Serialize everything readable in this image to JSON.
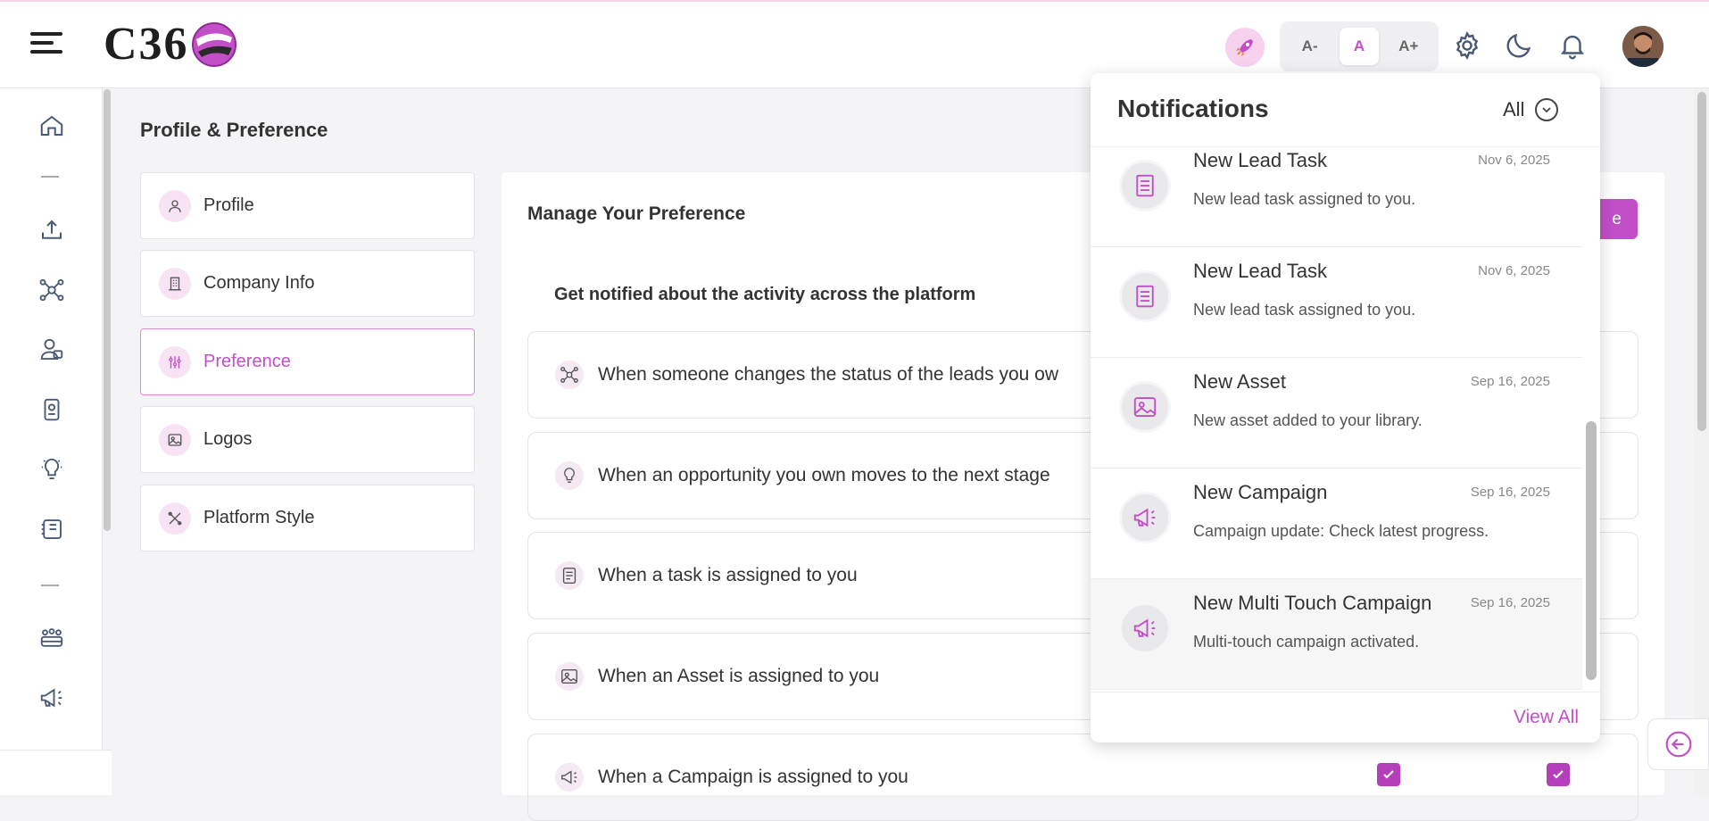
{
  "header": {
    "logo_text": "C36",
    "font_small": "A-",
    "font_normal": "A",
    "font_large": "A+"
  },
  "page": {
    "title": "Profile & Preference"
  },
  "profile_menu": [
    {
      "label": "Profile",
      "icon": "user-icon"
    },
    {
      "label": "Company Info",
      "icon": "building-icon"
    },
    {
      "label": "Preference",
      "icon": "sliders-icon",
      "active": true
    },
    {
      "label": "Logos",
      "icon": "image-icon"
    },
    {
      "label": "Platform Style",
      "icon": "tools-icon"
    }
  ],
  "preferences": {
    "title": "Manage Your Preference",
    "save_label": "Save",
    "save_visible": "e",
    "section_heading": "Get notified about the activity across the platform",
    "rows": [
      {
        "label": "When someone changes the status of the leads you ow",
        "icon": "network-icon"
      },
      {
        "label": "When an opportunity you own moves to the next stage",
        "icon": "bulb-icon"
      },
      {
        "label": "When a task is assigned to you",
        "icon": "task-icon"
      },
      {
        "label": "When an Asset is assigned to you",
        "icon": "image-icon"
      },
      {
        "label": "When a Campaign is assigned to you",
        "icon": "megaphone-icon",
        "email_checked": true,
        "inapp_checked": true
      }
    ]
  },
  "notifications": {
    "title": "Notifications",
    "filter": "All",
    "view_all": "View All",
    "items": [
      {
        "title": "New Lead Task",
        "date": "Nov 6, 2025",
        "body": "New lead task assigned to you.",
        "icon": "document-icon"
      },
      {
        "title": "New Lead Task",
        "date": "Nov 6, 2025",
        "body": "New lead task assigned to you.",
        "icon": "document-icon"
      },
      {
        "title": "New Asset",
        "date": "Sep 16, 2025",
        "body": "New asset added to your library.",
        "icon": "image-icon"
      },
      {
        "title": "New Campaign",
        "date": "Sep 16, 2025",
        "body": "Campaign update: Check latest progress.",
        "icon": "megaphone-icon"
      },
      {
        "title": "New Multi Touch Campaign",
        "date": "Sep 16, 2025",
        "body": "Multi-touch campaign activated.",
        "icon": "megaphone-icon"
      }
    ]
  },
  "colors": {
    "accent": "#c24fc7",
    "accent_light": "#f8e3f4"
  }
}
